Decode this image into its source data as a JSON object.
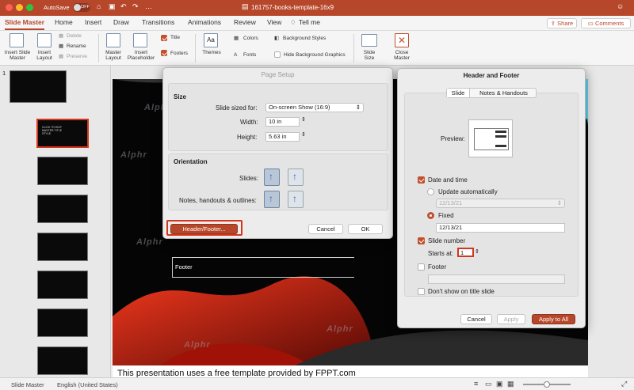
{
  "window": {
    "autosave_label": "AutoSave",
    "autosave_state": "OFF",
    "title": "161757-books-template-16x9"
  },
  "tabs": [
    "Slide Master",
    "Home",
    "Insert",
    "Draw",
    "Transitions",
    "Animations",
    "Review",
    "View"
  ],
  "tell_me": "Tell me",
  "share": "Share",
  "comments": "Comments",
  "ribbon": {
    "insert_slide_master": "Insert Slide Master",
    "insert_layout": "Insert Layout",
    "delete": "Delete",
    "rename": "Rename",
    "preserve": "Preserve",
    "master_layout": "Master Layout",
    "insert_placeholder": "Insert Placeholder",
    "title": "Title",
    "footers": "Footers",
    "themes": "Themes",
    "colors": "Colors",
    "fonts": "Fonts",
    "background_styles": "Background Styles",
    "hide_background_graphics": "Hide Background Graphics",
    "slide_size": "Slide Size",
    "close_master": "Close Master"
  },
  "thumbnail_number": "1",
  "thumb_title_text": "CLICK TO EDIT MASTER TITLE STYLE",
  "slide": {
    "footer_label": "Footer",
    "bottom_text": "This presentation uses a free template provided by FPPT.com",
    "watermark": "Alphr"
  },
  "page_setup": {
    "title": "Page Setup",
    "size_heading": "Size",
    "slide_sized_for_label": "Slide sized for:",
    "slide_sized_for_value": "On-screen Show (16:9)",
    "width_label": "Width:",
    "width_value": "10 in",
    "height_label": "Height:",
    "height_value": "5.63 in",
    "orientation_heading": "Orientation",
    "slides_label": "Slides:",
    "notes_label": "Notes, handouts & outlines:",
    "header_footer_btn": "Header/Footer...",
    "cancel": "Cancel",
    "ok": "OK"
  },
  "header_footer": {
    "title": "Header and Footer",
    "tab_slide": "Slide",
    "tab_notes": "Notes & Handouts",
    "preview_label": "Preview:",
    "date_time": "Date and time",
    "date_time_checked": true,
    "update_auto": "Update automatically",
    "update_value": "12/13/21",
    "fixed": "Fixed",
    "fixed_value": "12/13/21",
    "slide_number": "Slide number",
    "slide_number_checked": true,
    "starts_at_label": "Starts at:",
    "starts_at_value": "1",
    "footer": "Footer",
    "footer_checked": false,
    "dont_show": "Don't show on title slide",
    "dont_show_checked": false,
    "cancel": "Cancel",
    "apply": "Apply",
    "apply_all": "Apply to All"
  },
  "status": {
    "mode": "Slide Master",
    "language": "English (United States)"
  },
  "colors": {
    "accent": "#b7472a",
    "checkbox": "#c1502e",
    "highlight": "#d4351c"
  }
}
